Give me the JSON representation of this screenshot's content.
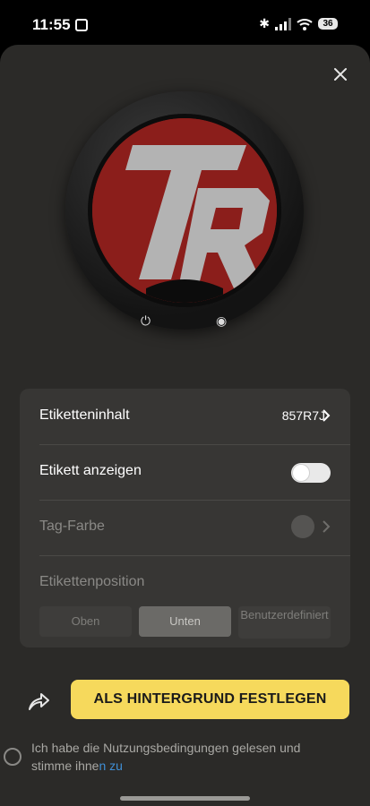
{
  "status_bar": {
    "time": "11:55",
    "battery": "36"
  },
  "settings": {
    "label_content": {
      "label": "Etiketteninhalt",
      "value": "857R7J"
    },
    "show_label": {
      "label": "Etikett anzeigen",
      "enabled": false
    },
    "tag_color": {
      "label": "Tag-Farbe",
      "color": "#555452"
    },
    "label_position": {
      "label": "Etikettenposition",
      "options": [
        "Oben",
        "Unten",
        "Benutzerdefiniert"
      ],
      "selected": "Unten"
    }
  },
  "actions": {
    "set_wallpaper_label": "ALS HINTERGRUND FESTLEGEN"
  },
  "terms": {
    "text": "Ich habe die Nutzungsbedingungen gelesen und stimme ihne",
    "link_text": "n zu"
  },
  "colors": {
    "accent_button": "#f6d95c",
    "sheet_bg": "#2b2a28",
    "panel_bg": "#373634",
    "face_red": "#8b1e1b"
  },
  "icons": {
    "close": "close-icon",
    "share": "share-icon",
    "chevron": "chevron-right-icon",
    "power": "power-icon",
    "record": "record-icon"
  }
}
